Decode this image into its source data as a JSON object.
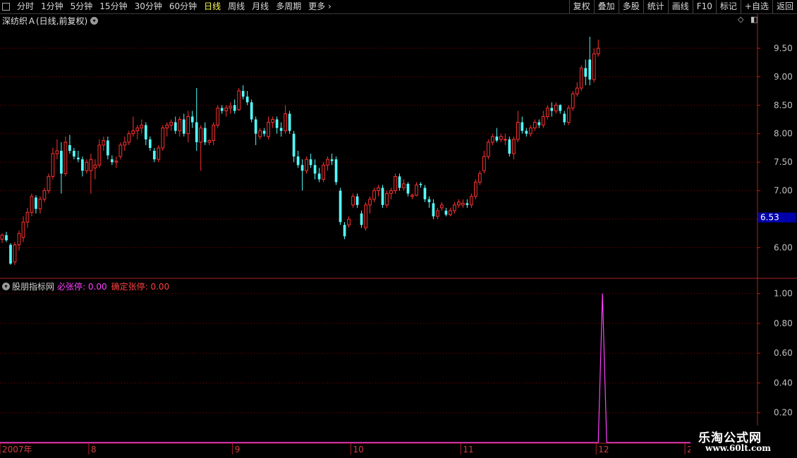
{
  "toolbar": {
    "periods": [
      "分时",
      "1分钟",
      "5分钟",
      "15分钟",
      "30分钟",
      "60分钟",
      "日线",
      "周线",
      "月线",
      "多周期",
      "更多"
    ],
    "active_period": "日线",
    "right_buttons": [
      "复权",
      "叠加",
      "多股",
      "统计",
      "画线",
      "F10",
      "标记",
      "+自选",
      "返回"
    ]
  },
  "stock": {
    "title": "深纺织Ａ(日线,前复权)"
  },
  "indicator": {
    "name": "股朋指标网",
    "bzt_label": "必张停: 0.00",
    "qdzt_label": "确定张停: 0.00"
  },
  "watermark": {
    "line1": "乐淘公式网",
    "line2": "www.60lt.com"
  },
  "colors": {
    "up": "#ff3232",
    "down": "#54fcfc",
    "grid": "#8b0000",
    "axis": "#b22222",
    "indicator": "#ff40ff",
    "price_tag": "#0000aa"
  },
  "chart_data": [
    {
      "type": "candlestick",
      "price_axis_labels": [
        "9.50",
        "9.00",
        "8.50",
        "8.00",
        "7.50",
        "7.00",
        "6.50",
        "6.00"
      ],
      "price_range": [
        5.5,
        9.9
      ],
      "last_price_tag": "6.53",
      "x_labels": [
        "2007年",
        "8",
        "9",
        "10",
        "11",
        "12",
        "2"
      ],
      "x_label_index": [
        0,
        21,
        55,
        83,
        109,
        141,
        162
      ],
      "n_bars": 179,
      "bars": [
        [
          6.15,
          6.25,
          6.08,
          6.22
        ],
        [
          6.22,
          6.28,
          6.1,
          6.13
        ],
        [
          6.05,
          6.08,
          5.7,
          5.72
        ],
        [
          5.75,
          6.1,
          5.7,
          6.05
        ],
        [
          6.05,
          6.3,
          5.95,
          6.25
        ],
        [
          6.18,
          6.55,
          6.1,
          6.45
        ],
        [
          6.45,
          6.7,
          6.35,
          6.62
        ],
        [
          6.62,
          6.95,
          6.55,
          6.9
        ],
        [
          6.88,
          6.92,
          6.6,
          6.68
        ],
        [
          6.68,
          6.9,
          6.6,
          6.85
        ],
        [
          6.85,
          7.05,
          6.8,
          7.0
        ],
        [
          7.0,
          7.3,
          6.95,
          7.25
        ],
        [
          7.25,
          7.75,
          7.2,
          7.65
        ],
        [
          7.65,
          7.9,
          7.55,
          7.7
        ],
        [
          7.7,
          7.85,
          6.95,
          7.3
        ],
        [
          7.3,
          7.95,
          7.25,
          7.85
        ],
        [
          7.8,
          7.98,
          7.65,
          7.7
        ],
        [
          7.7,
          7.75,
          7.55,
          7.6
        ],
        [
          7.58,
          7.7,
          7.5,
          7.55
        ],
        [
          7.55,
          7.6,
          7.25,
          7.35
        ],
        [
          7.35,
          7.55,
          7.3,
          7.5
        ],
        [
          7.35,
          7.65,
          6.95,
          7.55
        ],
        [
          7.4,
          7.55,
          7.2,
          7.45
        ],
        [
          7.45,
          7.9,
          7.4,
          7.8
        ],
        [
          7.8,
          7.95,
          7.7,
          7.88
        ],
        [
          7.88,
          7.95,
          7.55,
          7.62
        ],
        [
          7.55,
          7.62,
          7.45,
          7.5
        ],
        [
          7.5,
          7.6,
          7.4,
          7.52
        ],
        [
          7.6,
          7.85,
          7.55,
          7.8
        ],
        [
          7.8,
          7.95,
          7.7,
          7.85
        ],
        [
          7.85,
          8.05,
          7.8,
          8.0
        ],
        [
          8.0,
          8.3,
          7.95,
          8.05
        ],
        [
          8.05,
          8.15,
          7.9,
          8.1
        ],
        [
          8.1,
          8.25,
          8.0,
          8.15
        ],
        [
          8.15,
          8.2,
          7.8,
          7.9
        ],
        [
          7.9,
          7.95,
          7.7,
          7.75
        ],
        [
          7.7,
          7.75,
          7.5,
          7.55
        ],
        [
          7.55,
          7.8,
          7.5,
          7.75
        ],
        [
          7.75,
          8.15,
          7.7,
          8.1
        ],
        [
          8.1,
          8.2,
          7.95,
          8.15
        ],
        [
          8.15,
          8.25,
          8.05,
          8.2
        ],
        [
          8.2,
          8.3,
          8.0,
          8.05
        ],
        [
          8.05,
          8.3,
          7.95,
          8.25
        ],
        [
          8.25,
          8.35,
          7.95,
          8.0
        ],
        [
          8.0,
          8.4,
          7.85,
          8.3
        ],
        [
          8.3,
          8.4,
          8.1,
          8.2
        ],
        [
          8.2,
          8.8,
          7.7,
          7.85
        ],
        [
          7.85,
          8.15,
          7.35,
          8.1
        ],
        [
          8.1,
          8.2,
          7.8,
          7.85
        ],
        [
          7.85,
          7.9,
          7.8,
          7.88
        ],
        [
          7.88,
          8.2,
          7.8,
          8.15
        ],
        [
          8.15,
          8.5,
          8.1,
          8.45
        ],
        [
          8.45,
          8.5,
          8.35,
          8.4
        ],
        [
          8.4,
          8.5,
          8.3,
          8.45
        ],
        [
          8.45,
          8.55,
          8.35,
          8.48
        ],
        [
          8.5,
          8.6,
          8.35,
          8.4
        ],
        [
          8.42,
          8.8,
          8.4,
          8.75
        ],
        [
          8.75,
          8.85,
          8.6,
          8.65
        ],
        [
          8.65,
          8.75,
          8.5,
          8.55
        ],
        [
          8.55,
          8.6,
          8.2,
          8.25
        ],
        [
          8.25,
          8.3,
          7.8,
          8.0
        ],
        [
          7.95,
          8.1,
          7.9,
          8.05
        ],
        [
          8.05,
          8.1,
          7.95,
          8.0
        ],
        [
          7.95,
          8.3,
          7.9,
          8.2
        ],
        [
          8.2,
          8.3,
          8.1,
          8.25
        ],
        [
          8.25,
          8.3,
          8.0,
          8.1
        ],
        [
          8.1,
          8.2,
          7.95,
          8.05
        ],
        [
          8.05,
          8.5,
          8.0,
          8.35
        ],
        [
          8.35,
          8.4,
          8.0,
          8.05
        ],
        [
          8.0,
          8.05,
          7.5,
          7.6
        ],
        [
          7.6,
          7.7,
          7.4,
          7.45
        ],
        [
          7.45,
          7.55,
          7.0,
          7.35
        ],
        [
          7.35,
          7.6,
          7.3,
          7.55
        ],
        [
          7.55,
          7.65,
          7.4,
          7.45
        ],
        [
          7.45,
          7.55,
          7.2,
          7.3
        ],
        [
          7.3,
          7.4,
          7.15,
          7.2
        ],
        [
          7.2,
          7.5,
          7.15,
          7.45
        ],
        [
          7.45,
          7.6,
          7.35,
          7.55
        ],
        [
          7.55,
          7.65,
          7.45,
          7.52
        ],
        [
          7.55,
          7.6,
          7.1,
          7.15
        ],
        [
          7.0,
          7.05,
          6.4,
          6.45
        ],
        [
          6.4,
          6.45,
          6.15,
          6.2
        ],
        [
          6.4,
          6.55,
          6.35,
          6.5
        ],
        [
          6.75,
          6.95,
          6.7,
          6.9
        ],
        [
          6.9,
          6.95,
          6.7,
          6.75
        ],
        [
          6.6,
          6.65,
          6.35,
          6.4
        ],
        [
          6.35,
          6.8,
          6.3,
          6.75
        ],
        [
          6.75,
          6.9,
          6.6,
          6.85
        ],
        [
          6.85,
          7.05,
          6.8,
          7.0
        ],
        [
          7.0,
          7.1,
          6.9,
          7.05
        ],
        [
          7.05,
          7.1,
          6.7,
          6.75
        ],
        [
          6.75,
          7.0,
          6.7,
          6.95
        ],
        [
          6.95,
          7.05,
          6.85,
          7.0
        ],
        [
          7.0,
          7.3,
          6.95,
          7.25
        ],
        [
          7.25,
          7.3,
          7.0,
          7.05
        ],
        [
          7.05,
          7.2,
          7.0,
          7.12
        ],
        [
          7.12,
          7.15,
          6.9,
          6.95
        ],
        [
          6.9,
          6.95,
          6.85,
          6.92
        ],
        [
          6.92,
          7.15,
          6.9,
          7.1
        ],
        [
          7.12,
          7.15,
          7.05,
          7.1
        ],
        [
          7.05,
          7.1,
          6.8,
          6.85
        ],
        [
          6.85,
          6.9,
          6.7,
          6.8
        ],
        [
          6.78,
          6.85,
          6.5,
          6.55
        ],
        [
          6.55,
          6.7,
          6.5,
          6.65
        ],
        [
          6.7,
          6.8,
          6.65,
          6.75
        ],
        [
          6.65,
          6.7,
          6.55,
          6.58
        ],
        [
          6.58,
          6.7,
          6.55,
          6.65
        ],
        [
          6.65,
          6.8,
          6.6,
          6.75
        ],
        [
          6.75,
          6.85,
          6.7,
          6.8
        ],
        [
          6.75,
          6.85,
          6.7,
          6.78
        ],
        [
          6.78,
          6.85,
          6.7,
          6.75
        ],
        [
          6.75,
          6.95,
          6.7,
          6.9
        ],
        [
          6.9,
          7.2,
          6.85,
          7.15
        ],
        [
          7.15,
          7.35,
          7.1,
          7.3
        ],
        [
          7.35,
          7.7,
          7.3,
          7.6
        ],
        [
          7.6,
          7.9,
          7.55,
          7.85
        ],
        [
          7.85,
          8.0,
          7.8,
          7.95
        ],
        [
          7.95,
          8.1,
          7.85,
          7.88
        ],
        [
          7.9,
          8.0,
          7.85,
          7.95
        ],
        [
          7.9,
          8.0,
          7.8,
          7.9
        ],
        [
          7.9,
          7.95,
          7.6,
          7.65
        ],
        [
          7.65,
          7.95,
          7.55,
          7.9
        ],
        [
          7.9,
          8.4,
          7.85,
          8.2
        ],
        [
          8.2,
          8.3,
          8.0,
          8.05
        ],
        [
          8.05,
          8.1,
          7.95,
          8.0
        ],
        [
          8.0,
          8.15,
          7.95,
          8.1
        ],
        [
          8.1,
          8.25,
          8.05,
          8.2
        ],
        [
          8.2,
          8.25,
          8.1,
          8.15
        ],
        [
          8.15,
          8.4,
          8.1,
          8.3
        ],
        [
          8.3,
          8.5,
          8.25,
          8.45
        ],
        [
          8.45,
          8.55,
          8.3,
          8.4
        ],
        [
          8.4,
          8.55,
          8.35,
          8.5
        ],
        [
          8.5,
          8.52,
          8.35,
          8.4
        ],
        [
          8.35,
          8.4,
          8.15,
          8.2
        ],
        [
          8.2,
          8.5,
          8.15,
          8.45
        ],
        [
          8.45,
          8.75,
          8.4,
          8.7
        ],
        [
          8.7,
          8.9,
          8.65,
          8.8
        ],
        [
          8.8,
          9.2,
          8.75,
          9.15
        ],
        [
          9.15,
          9.3,
          8.85,
          9.0
        ],
        [
          9.3,
          9.7,
          8.85,
          8.95
        ],
        [
          8.95,
          9.5,
          8.9,
          9.4
        ],
        [
          9.4,
          9.65,
          9.35,
          9.5
        ]
      ]
    },
    {
      "type": "line",
      "y_axis_labels": [
        "1.00",
        "0.80",
        "0.60",
        "0.40",
        "0.20"
      ],
      "y_range": [
        0,
        1.06
      ],
      "spike": {
        "bar_index": 142,
        "value": 1.0
      }
    }
  ]
}
